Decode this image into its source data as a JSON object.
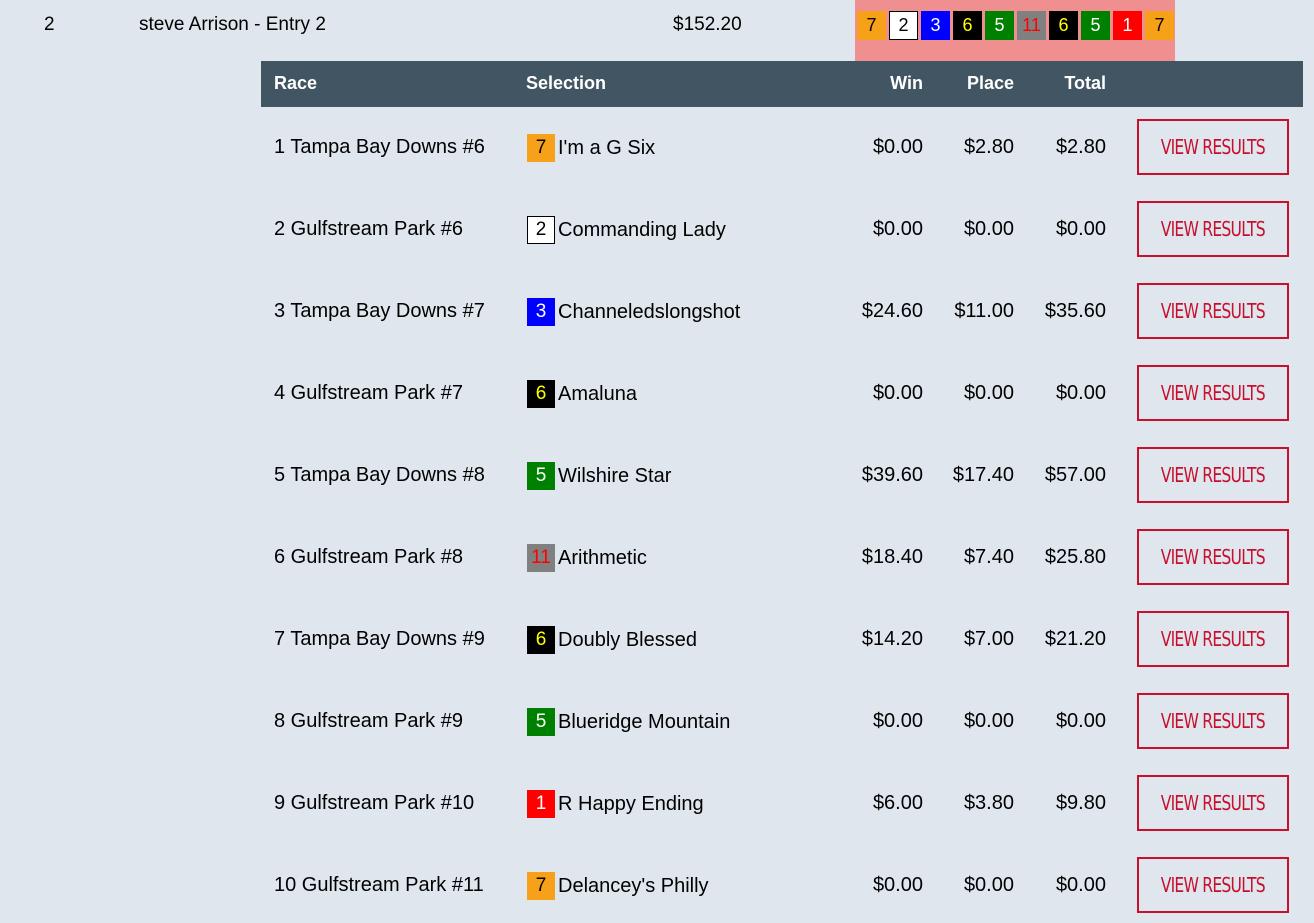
{
  "entry": {
    "rank": "2",
    "name": "steve Arrison - Entry 2",
    "total": "$152.20",
    "picks": [
      {
        "num": "7",
        "bg": "#f7a11a",
        "fg": "#000000",
        "border": "#f7a11a"
      },
      {
        "num": "2",
        "bg": "#ffffff",
        "fg": "#000000",
        "border": "#000000"
      },
      {
        "num": "3",
        "bg": "#0000ff",
        "fg": "#ffffff",
        "border": "#0000ff"
      },
      {
        "num": "6",
        "bg": "#000000",
        "fg": "#ffff00",
        "border": "#000000"
      },
      {
        "num": "5",
        "bg": "#008000",
        "fg": "#ffffff",
        "border": "#008000"
      },
      {
        "num": "11",
        "bg": "#808080",
        "fg": "#ff0000",
        "border": "#808080"
      },
      {
        "num": "6",
        "bg": "#000000",
        "fg": "#ffff00",
        "border": "#000000"
      },
      {
        "num": "5",
        "bg": "#008000",
        "fg": "#ffffff",
        "border": "#008000"
      },
      {
        "num": "1",
        "bg": "#ff0000",
        "fg": "#ffffff",
        "border": "#ff0000"
      },
      {
        "num": "7",
        "bg": "#f7a11a",
        "fg": "#000000",
        "border": "#f7a11a"
      }
    ]
  },
  "table": {
    "headers": {
      "race": "Race",
      "selection": "Selection",
      "win": "Win",
      "place": "Place",
      "total": "Total"
    },
    "button_label": "VIEW RESULTS",
    "rows": [
      {
        "race": "1 Tampa Bay Downs #6",
        "num": "7",
        "bg": "#f7a11a",
        "fg": "#000000",
        "border": "#f7a11a",
        "horse": "I'm a G Six",
        "win": "$0.00",
        "place": "$2.80",
        "total": "$2.80"
      },
      {
        "race": "2 Gulfstream Park #6",
        "num": "2",
        "bg": "#ffffff",
        "fg": "#000000",
        "border": "#000000",
        "horse": "Commanding Lady",
        "win": "$0.00",
        "place": "$0.00",
        "total": "$0.00"
      },
      {
        "race": "3 Tampa Bay Downs #7",
        "num": "3",
        "bg": "#0000ff",
        "fg": "#ffffff",
        "border": "#0000ff",
        "horse": "Channeledslongshot",
        "win": "$24.60",
        "place": "$11.00",
        "total": "$35.60"
      },
      {
        "race": "4 Gulfstream Park #7",
        "num": "6",
        "bg": "#000000",
        "fg": "#ffff00",
        "border": "#000000",
        "horse": "Amaluna",
        "win": "$0.00",
        "place": "$0.00",
        "total": "$0.00"
      },
      {
        "race": "5 Tampa Bay Downs #8",
        "num": "5",
        "bg": "#008000",
        "fg": "#ffffff",
        "border": "#008000",
        "horse": "Wilshire Star",
        "win": "$39.60",
        "place": "$17.40",
        "total": "$57.00"
      },
      {
        "race": "6 Gulfstream Park #8",
        "num": "11",
        "bg": "#808080",
        "fg": "#ff0000",
        "border": "#808080",
        "horse": "Arithmetic",
        "win": "$18.40",
        "place": "$7.40",
        "total": "$25.80"
      },
      {
        "race": "7 Tampa Bay Downs #9",
        "num": "6",
        "bg": "#000000",
        "fg": "#ffff00",
        "border": "#000000",
        "horse": "Doubly Blessed",
        "win": "$14.20",
        "place": "$7.00",
        "total": "$21.20"
      },
      {
        "race": "8 Gulfstream Park #9",
        "num": "5",
        "bg": "#008000",
        "fg": "#ffffff",
        "border": "#008000",
        "horse": "Blueridge Mountain",
        "win": "$0.00",
        "place": "$0.00",
        "total": "$0.00"
      },
      {
        "race": "9 Gulfstream Park #10",
        "num": "1",
        "bg": "#ff0000",
        "fg": "#ffffff",
        "border": "#ff0000",
        "horse": "R Happy Ending",
        "win": "$6.00",
        "place": "$3.80",
        "total": "$9.80"
      },
      {
        "race": "10 Gulfstream Park #11",
        "num": "7",
        "bg": "#f7a11a",
        "fg": "#000000",
        "border": "#f7a11a",
        "horse": "Delancey's Philly",
        "win": "$0.00",
        "place": "$0.00",
        "total": "$0.00"
      }
    ]
  }
}
